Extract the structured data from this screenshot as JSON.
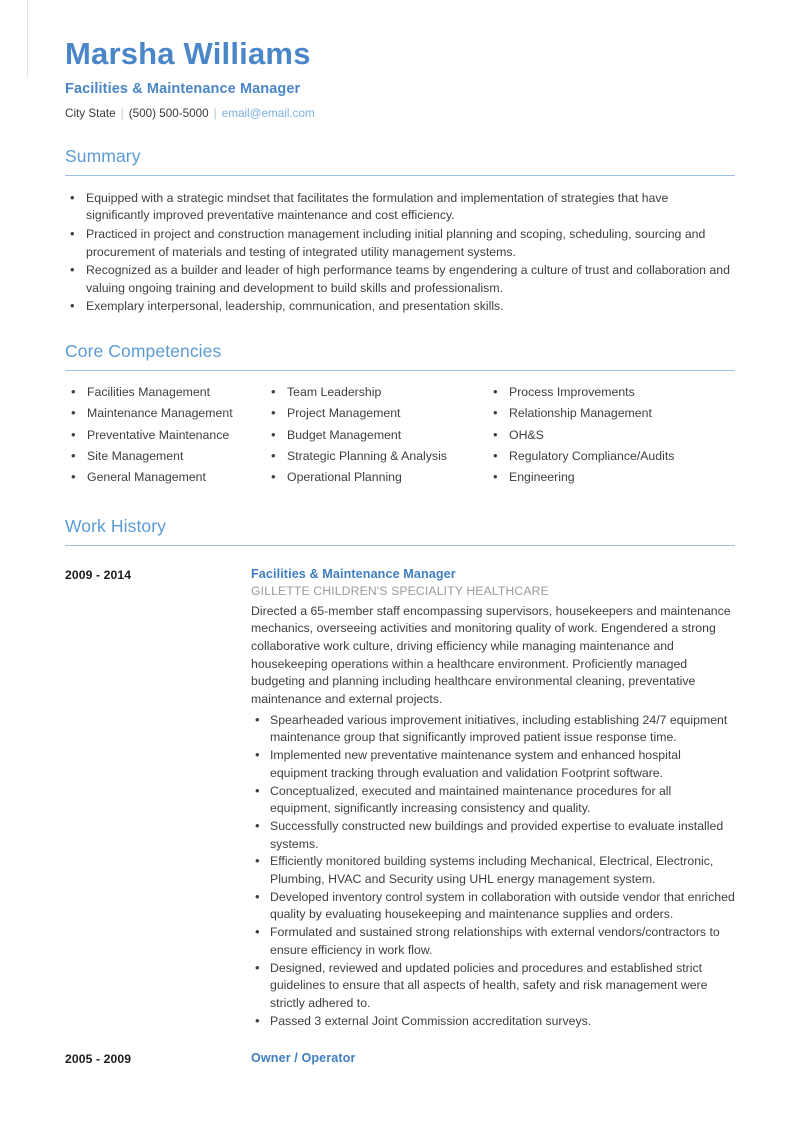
{
  "header": {
    "name": "Marsha Williams",
    "title": "Facilities & Maintenance Manager",
    "location": "City State",
    "phone": "(500) 500-5000",
    "email": "email@email.com",
    "separator": "|"
  },
  "colors": {
    "name_blue": "#4a86c8",
    "section_heading_blue": "#5b9bd5",
    "rule_blue": "#9dc3e6",
    "role_blue": "#3f7fc1",
    "email_blue": "#7bb0e0",
    "company_gray": "#9b9b9b",
    "body_text": "#3f3f3f"
  },
  "summary": {
    "heading": "Summary",
    "bullets": [
      " Equipped with a strategic mindset that facilitates the formulation and implementation of strategies that have significantly improved preventative maintenance and cost efficiency.",
      "Practiced in project and construction management including initial planning and scoping, scheduling, sourcing and procurement of materials and testing of integrated utility management systems.",
      "Recognized as a builder and leader of high performance teams by engendering a culture of trust and collaboration and valuing ongoing training and development to build skills and professionalism.",
      "Exemplary interpersonal, leadership, communication, and presentation skills."
    ]
  },
  "competencies": {
    "heading": "Core Competencies",
    "columns": [
      [
        "Facilities Management",
        "Maintenance Management",
        "Preventative Maintenance",
        "Site Management",
        "General Management"
      ],
      [
        "Team Leadership",
        "Project Management",
        "Budget Management",
        "Strategic Planning & Analysis",
        "Operational Planning"
      ],
      [
        "Process Improvements",
        "Relationship Management",
        "OH&S",
        "Regulatory Compliance/Audits",
        "Engineering"
      ]
    ]
  },
  "work_history": {
    "heading": "Work History",
    "jobs": [
      {
        "dates": "2009 - 2014",
        "role": "Facilities & Maintenance Manager",
        "company": "GILLETTE CHILDREN'S SPECIALITY HEALTHCARE",
        "description": "Directed a 65-member staff encompassing supervisors, housekeepers and maintenance mechanics, overseeing activities and monitoring quality of work. Engendered a strong collaborative work culture, driving efficiency while managing maintenance and housekeeping operations within a healthcare environment. Proficiently managed budgeting and planning including healthcare environmental cleaning, preventative maintenance and external projects.",
        "points": [
          "Spearheaded various improvement initiatives, including establishing 24/7 equipment maintenance group that significantly improved patient issue response time.",
          "Implemented new preventative maintenance system and enhanced hospital equipment tracking through evaluation and validation Footprint software.",
          "Conceptualized, executed and maintained maintenance procedures for all equipment, significantly increasing consistency and quality.",
          "Successfully constructed new buildings and provided expertise to evaluate installed systems.",
          "Efficiently monitored building systems including Mechanical, Electrical, Electronic, Plumbing, HVAC and Security using UHL energy management system.",
          "Developed inventory control system in collaboration with outside vendor that enriched quality by evaluating housekeeping and maintenance supplies and orders.",
          "Formulated and sustained strong relationships with external vendors/contractors to ensure efficiency in work flow.",
          "Designed, reviewed and updated policies and procedures and established strict guidelines to ensure that all aspects of health, safety and risk management were strictly adhered to.",
          "Passed 3 external Joint Commission accreditation surveys."
        ]
      },
      {
        "dates": "2005 - 2009",
        "role": "Owner / Operator",
        "company": "",
        "description": "",
        "points": []
      }
    ]
  }
}
